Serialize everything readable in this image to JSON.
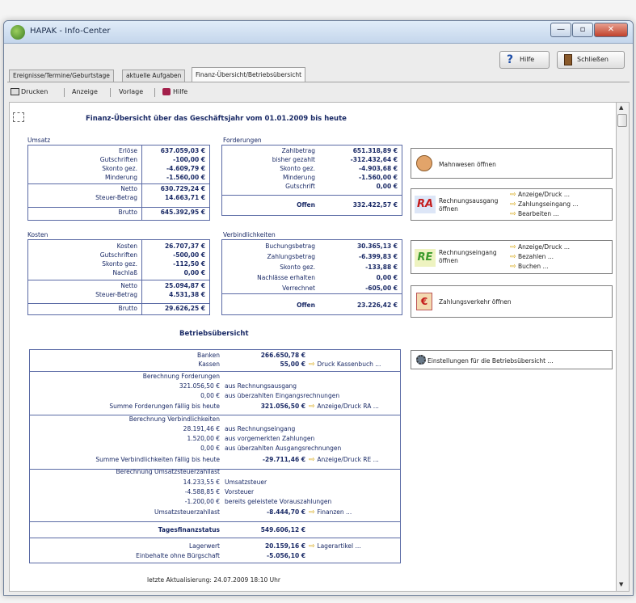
{
  "window": {
    "title": "HAPAK - Info-Center",
    "help_label": "Hilfe",
    "close_label": "Schließen"
  },
  "tabs": [
    "Ereignisse/Termine/Geburtstage",
    "aktuelle Aufgaben",
    "Finanz-Übersicht/Betriebsübersicht"
  ],
  "subtoolbar": {
    "print": "Drucken",
    "view": "Anzeige",
    "template": "Vorlage",
    "help": "Hilfe"
  },
  "heading": "Finanz-Übersicht über das Geschäftsjahr vom 01.01.2009 bis heute",
  "umsatz": {
    "title": "Umsatz",
    "rows": [
      [
        "Erlöse",
        "637.059,03 €"
      ],
      [
        "Gutschriften",
        "-100,00 €"
      ],
      [
        "Skonto gez.",
        "-4.609,79 €"
      ],
      [
        "Minderung",
        "-1.560,00 €"
      ]
    ],
    "netto": [
      "Netto",
      "630.729,24 €"
    ],
    "steuer": [
      "Steuer-Betrag",
      "14.663,71 €"
    ],
    "brutto": [
      "Brutto",
      "645.392,95 €"
    ]
  },
  "forderungen": {
    "title": "Forderungen",
    "rows": [
      [
        "Zahlbetrag",
        "651.318,89 €"
      ],
      [
        "bisher gezahlt",
        "-312.432,64 €"
      ],
      [
        "Skonto gez.",
        "-4.903,68 €"
      ],
      [
        "Minderung",
        "-1.560,00 €"
      ],
      [
        "Gutschrift",
        "0,00 €"
      ]
    ],
    "offen": [
      "Offen",
      "332.422,57 €"
    ]
  },
  "kosten": {
    "title": "Kosten",
    "rows": [
      [
        "Kosten",
        "26.707,37 €"
      ],
      [
        "Gutschriften",
        "-500,00 €"
      ],
      [
        "Skonto gez.",
        "-112,50 €"
      ],
      [
        "Nachlaß",
        "0,00 €"
      ]
    ],
    "netto": [
      "Netto",
      "25.094,87 €"
    ],
    "steuer": [
      "Steuer-Betrag",
      "4.531,38 €"
    ],
    "brutto": [
      "Brutto",
      "29.626,25 €"
    ]
  },
  "verbindlichkeiten": {
    "title": "Verbindlichkeiten",
    "rows": [
      [
        "Buchungsbetrag",
        "30.365,13 €"
      ],
      [
        "Zahlungsbetrag",
        "-6.399,83 €"
      ],
      [
        "Skonto gez.",
        "-133,88 €"
      ],
      [
        "Nachlässe erhalten",
        "0,00 €"
      ],
      [
        "Verrechnet",
        "-605,00 €"
      ]
    ],
    "offen": [
      "Offen",
      "23.226,42 €"
    ]
  },
  "side": {
    "mahn": "Mahnwesen öffnen",
    "ra_title": "Rechnungsausgang öffnen",
    "ra_links": [
      "Anzeige/Druck ...",
      "Zahlungseingang ...",
      "Bearbeiten ..."
    ],
    "re_title": "Rechnungseingang öffnen",
    "re_links": [
      "Anzeige/Druck ...",
      "Bezahlen ...",
      "Buchen ..."
    ],
    "zv": "Zahlungsverkehr öffnen",
    "settings": "Einstellungen für die Betriebsübersicht ..."
  },
  "betrieb": {
    "title": "Betriebsübersicht",
    "banken": [
      "Banken",
      "266.650,78 €"
    ],
    "kassen": [
      "Kassen",
      "55,00 €",
      "Druck Kassenbuch ..."
    ],
    "bf_title": "Berechnung Forderungen",
    "bf_rows": [
      [
        "321.056,50 €",
        "aus Rechnungsausgang"
      ],
      [
        "0,00 €",
        "aus überzahlten Eingangsrechnungen"
      ]
    ],
    "bf_sum": [
      "Summe Forderungen fällig bis heute",
      "321.056,50 €",
      "Anzeige/Druck RA ..."
    ],
    "bv_title": "Berechnung Verbindlichkeiten",
    "bv_rows": [
      [
        "28.191,46 €",
        "aus Rechnungseingang"
      ],
      [
        "1.520,00 €",
        "aus vorgemerkten Zahlungen"
      ],
      [
        "0,00 €",
        "aus überzahlten Ausgangsrechnungen"
      ]
    ],
    "bv_sum": [
      "Summe Verbindlichkeiten fällig bis heute",
      "-29.711,46 €",
      "Anzeige/Druck RE ..."
    ],
    "bu_title": "Berechnung Umsatzsteuerzahllast",
    "bu_rows": [
      [
        "14.233,55 €",
        "Umsatzsteuer"
      ],
      [
        "-4.588,85 €",
        "Vorsteuer"
      ],
      [
        "-1.200,00 €",
        "bereits geleistete Vorauszahlungen"
      ]
    ],
    "bu_sum": [
      "Umsatzsteuerzahllast",
      "-8.444,70 €",
      "Finanzen ..."
    ],
    "tages": [
      "Tagesfinanzstatus",
      "549.606,12 €"
    ],
    "lager": [
      "Lagerwert",
      "20.159,16 €",
      "Lagerartikel ..."
    ],
    "einbehalt": [
      "Einbehalte ohne Bürgschaft",
      "-5.056,10 €"
    ]
  },
  "footer": "letzte Aktualisierung:  24.07.2009 18:10 Uhr"
}
